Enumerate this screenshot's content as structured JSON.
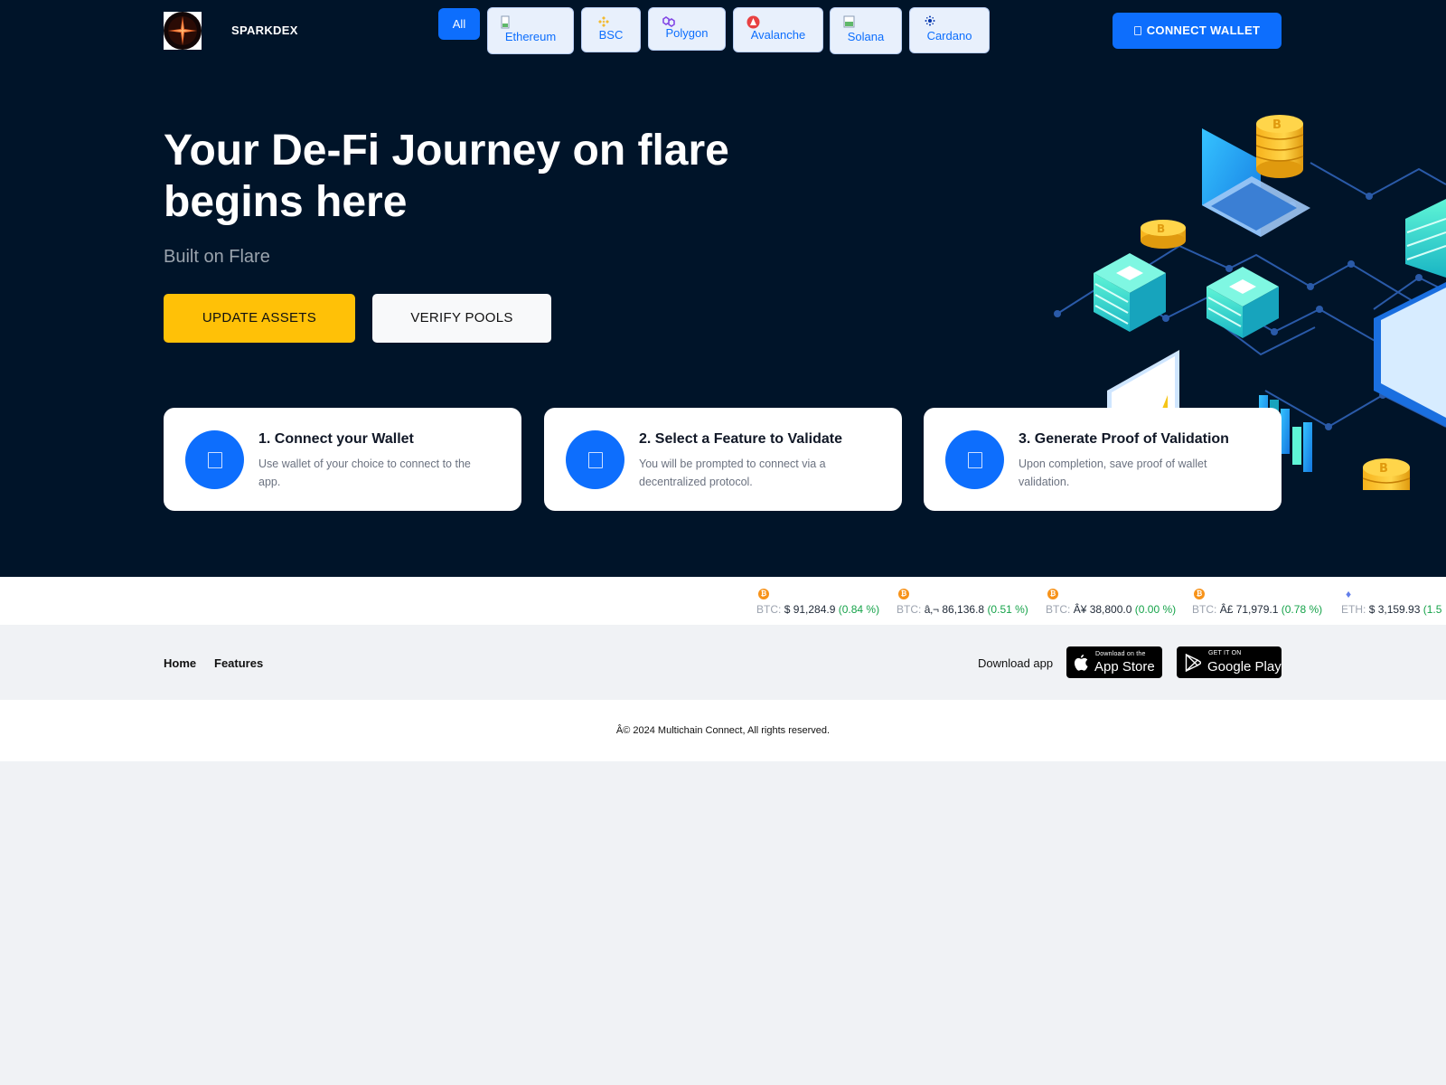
{
  "header": {
    "brand": "SPARKDEX",
    "chains": {
      "all": "All",
      "ethereum": "Ethereum",
      "bsc": "BSC",
      "polygon": "Polygon",
      "avalanche": "Avalanche",
      "solana": "Solana",
      "cardano": "Cardano"
    },
    "connect_label": "CONNECT WALLET"
  },
  "hero": {
    "title_line1": "Your De-Fi Journey on flare",
    "title_line2": "begins here",
    "subtitle": "Built on Flare",
    "primary_button": "UPDATE ASSETS",
    "secondary_button": "VERIFY POOLS"
  },
  "steps": [
    {
      "title": "1. Connect your Wallet",
      "desc": "Use wallet of your choice to connect to the app."
    },
    {
      "title": "2. Select a Feature to Validate",
      "desc": "You will be prompted to connect via a decentralized protocol."
    },
    {
      "title": "3. Generate Proof of Validation",
      "desc": "Upon completion, save proof of wallet validation."
    }
  ],
  "ticker": [
    {
      "symbol": "BTC:",
      "price": "$ 91,284.9",
      "change": "(0.84 %)",
      "icon": "bitcoin-icon"
    },
    {
      "symbol": "BTC:",
      "price": "â‚¬ 86,136.8",
      "change": "(0.51 %)",
      "icon": "bitcoin-icon"
    },
    {
      "symbol": "BTC:",
      "price": "Â¥ 38,800.0",
      "change": "(0.00 %)",
      "icon": "bitcoin-icon"
    },
    {
      "symbol": "BTC:",
      "price": "Â£ 71,979.1",
      "change": "(0.78 %)",
      "icon": "bitcoin-icon"
    },
    {
      "symbol": "ETH:",
      "price": "$ 3,159.93",
      "change": "(1.5",
      "icon": "ethereum-icon"
    }
  ],
  "footer": {
    "links": {
      "home": "Home",
      "features": "Features"
    },
    "download_label": "Download app",
    "app_store": {
      "small": "Download on the",
      "big": "App Store"
    },
    "google_play": {
      "small": "GET IT ON",
      "big": "Google Play"
    },
    "copyright": "Â© 2024 Multichain Connect, All rights reserved."
  },
  "colors": {
    "navy": "#001429",
    "primary": "#0d6efd",
    "yellow": "#ffc107",
    "positive": "#16a34a"
  }
}
